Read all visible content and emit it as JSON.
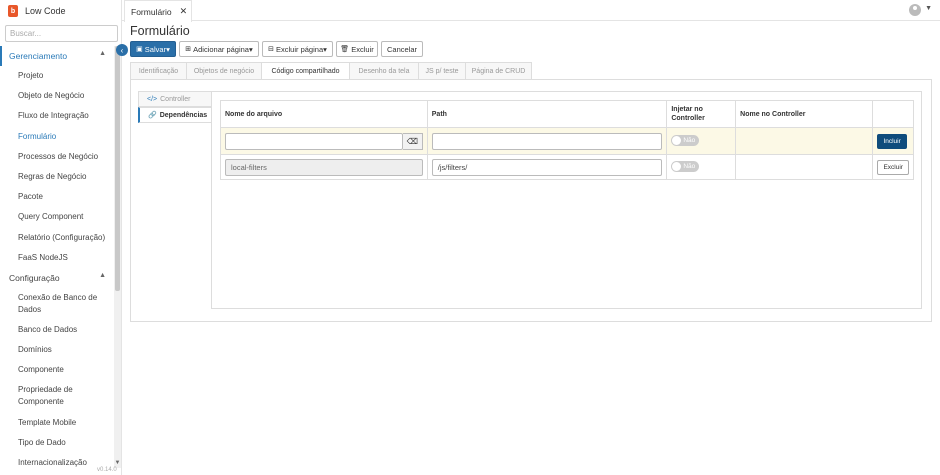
{
  "app": {
    "name": "Low Code",
    "logo_letter": "b",
    "version": "v0.14.0"
  },
  "sidebar": {
    "search_placeholder": "Buscar...",
    "sections": [
      {
        "label": "Gerenciamento",
        "items": [
          "Projeto",
          "Objeto de Negócio",
          "Fluxo de Integração",
          "Formulário",
          "Processos de Negócio",
          "Regras de Negócio",
          "Pacote",
          "Query Component",
          "Relatório (Configuração)",
          "FaaS NodeJS"
        ]
      },
      {
        "label": "Configuração",
        "items": [
          "Conexão de Banco de Dados",
          "Banco de Dados",
          "Domínios",
          "Componente",
          "Propriedade de Componente",
          "Template Mobile",
          "Tipo de Dado",
          "Internacionalização"
        ]
      }
    ],
    "current_item": "Formulário"
  },
  "topbar": {
    "tab_label": "Formulário"
  },
  "page": {
    "title": "Formulário"
  },
  "toolbar": {
    "save": "Salvar",
    "add_page": "Adicionar página",
    "delete_page": "Excluir página",
    "delete": "Excluir",
    "cancel": "Cancelar"
  },
  "section_tabs": [
    "Identificação",
    "Objetos de negócio",
    "Código compartilhado",
    "Desenho da tela",
    "JS p/ teste",
    "Página de CRUD"
  ],
  "active_section_tab": "Código compartilhado",
  "side_tabs": [
    "Controller",
    "Dependências"
  ],
  "active_side_tab": "Dependências",
  "table": {
    "headers": [
      "Nome do arquivo",
      "Path",
      "Injetar no Controller",
      "Nome no Controller",
      ""
    ],
    "new_row": {
      "filename": "",
      "path": "",
      "inject": "Não",
      "button": "Incluir"
    },
    "rows": [
      {
        "filename": "local-filters",
        "path": "/js/filters/",
        "inject": "Não",
        "controller_name": "",
        "button": "Excluir"
      }
    ]
  },
  "colors": {
    "primary": "#2a6fa8",
    "include_button": "#0f4c7c",
    "new_row_bg": "#fcf9e6",
    "logo": "#e8572a"
  }
}
